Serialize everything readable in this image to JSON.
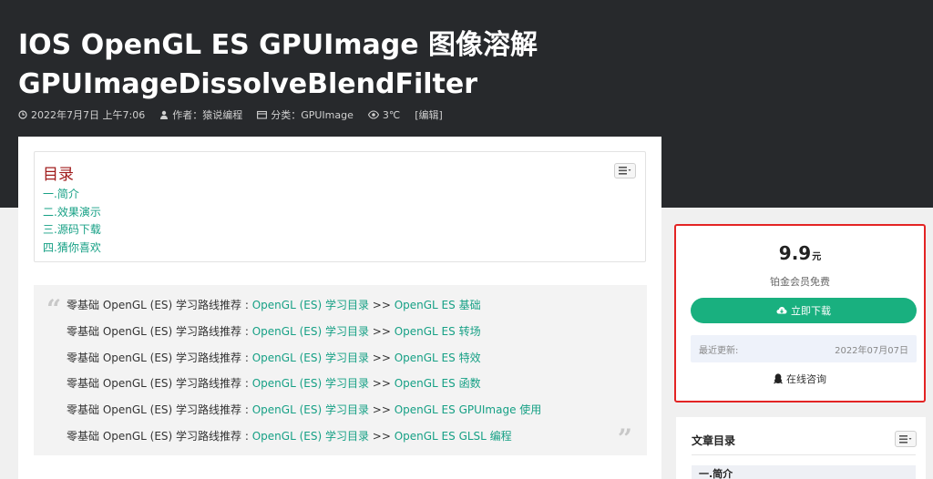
{
  "article": {
    "title": "IOS OpenGL ES GPUImage 图像溶解 GPUImageDissolveBlendFilter",
    "meta": {
      "date": "2022年7月7日 上午7:06",
      "author": "作者：猿说编程",
      "category": "分类：GPUImage",
      "views": "3℃",
      "edit": "[编辑]"
    },
    "toc": {
      "title": "目录",
      "items": [
        "一.简介",
        "二.效果演示",
        "三.源码下载",
        "四.猜你喜欢"
      ]
    },
    "quote": {
      "lines": [
        {
          "prefix": "零基础 OpenGL (ES) 学习路线推荐 : ",
          "link1": "OpenGL (ES) 学习目录",
          "sep": " >> ",
          "link2": "OpenGL ES 基础"
        },
        {
          "prefix": "零基础 OpenGL (ES) 学习路线推荐 : ",
          "link1": "OpenGL (ES) 学习目录",
          "sep": " >> ",
          "link2": "OpenGL ES 转场"
        },
        {
          "prefix": "零基础 OpenGL (ES) 学习路线推荐 : ",
          "link1": "OpenGL (ES) 学习目录",
          "sep": " >> ",
          "link2": "OpenGL ES 特效"
        },
        {
          "prefix": "零基础 OpenGL (ES) 学习路线推荐 : ",
          "link1": "OpenGL (ES) 学习目录",
          "sep": " >> ",
          "link2": "OpenGL ES 函数"
        },
        {
          "prefix": "零基础 OpenGL (ES) 学习路线推荐 : ",
          "link1": "OpenGL (ES) 学习目录",
          "sep": " >> ",
          "link2": "OpenGL ES GPUImage 使用"
        },
        {
          "prefix": "零基础 OpenGL (ES) 学习路线推荐 : ",
          "link1": "OpenGL (ES) 学习目录",
          "sep": " >> ",
          "link2": "OpenGL ES GLSL 编程"
        }
      ]
    }
  },
  "sidebar": {
    "download": {
      "price": "9.9",
      "currency": "元",
      "vip_note": "铂金会员免费",
      "button_label": "立即下载",
      "updated_label": "最近更新:",
      "updated_value": "2022年07月07日",
      "consult_label": "在线咨询"
    },
    "toc": {
      "title": "文章目录",
      "first_item": "一.简介"
    }
  },
  "colors": {
    "accent": "#16a085",
    "download_button": "#19b07f",
    "highlight_border": "#e32424",
    "header_bg": "#27292c",
    "toc_title": "#a01c1c"
  },
  "icons": {
    "date": "clock-icon",
    "author": "user-icon",
    "category": "folder-icon",
    "views": "eye-icon",
    "toc_toggle": "list-toggle-icon",
    "download": "cloud-download-icon",
    "consult": "qq-penguin-icon"
  }
}
